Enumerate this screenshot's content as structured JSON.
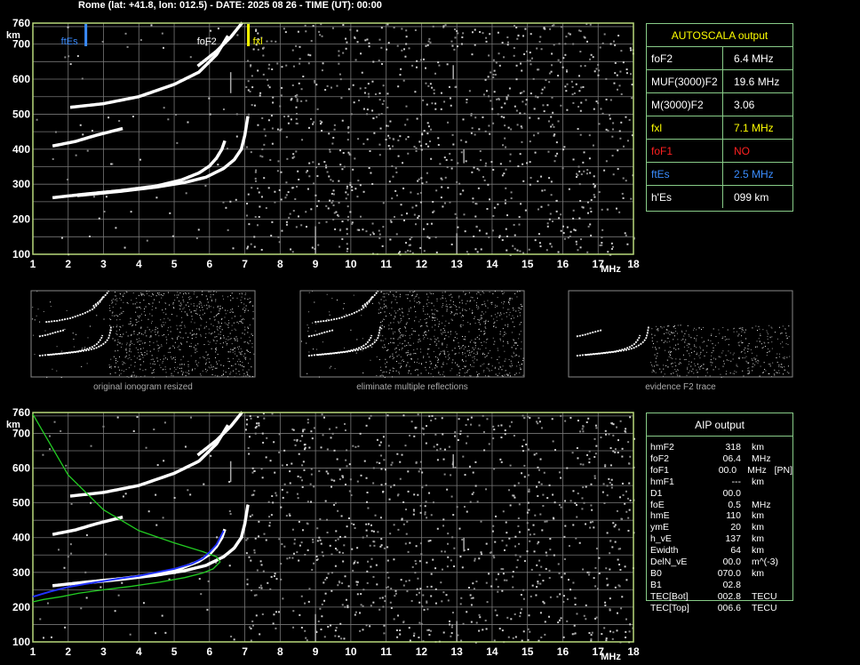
{
  "header": "Rome (lat: +41.8, lon: 012.5) - DATE: 2025 08 26 - TIME (UT): 00:00",
  "colors": {
    "grid": "#777777",
    "frame": "#b8d87a",
    "fxl": "#ffff00",
    "ftes": "#3a8cff",
    "fof1": "#ff2020",
    "model": "#22cc22",
    "profile": "#2233ff"
  },
  "chart_data": [
    {
      "type": "scatter",
      "name": "ionogram",
      "x_ticks": [
        1,
        2,
        3,
        4,
        5,
        6,
        7,
        8,
        9,
        10,
        11,
        12,
        13,
        14,
        15,
        16,
        17,
        18
      ],
      "y_ticks": [
        100,
        200,
        300,
        400,
        500,
        600,
        700,
        760
      ],
      "xlim": [
        1,
        18
      ],
      "ylim": [
        100,
        760
      ],
      "xlabel": "MHz",
      "ylabel": "km",
      "grid": true,
      "markers": [
        {
          "label": "ftEs",
          "x": 2.5
        },
        {
          "label": "foF2",
          "x": 6.4
        },
        {
          "label": "fxl",
          "x": 7.1
        }
      ],
      "traces": [
        {
          "name": "F2 ordinary low",
          "x": [
            1.6,
            2.5,
            3.5,
            4.5,
            5.2,
            5.7,
            6.0,
            6.2,
            6.35,
            6.42
          ],
          "y": [
            262,
            272,
            282,
            295,
            312,
            332,
            352,
            375,
            400,
            420
          ]
        },
        {
          "name": "F2 extraordinary low",
          "x": [
            2.3,
            3.5,
            4.5,
            5.3,
            5.9,
            6.4,
            6.7,
            6.9,
            7.0,
            7.08
          ],
          "y": [
            268,
            280,
            292,
            305,
            320,
            345,
            370,
            400,
            440,
            490
          ]
        },
        {
          "name": "F2 second hop",
          "x": [
            1.6,
            2.2,
            2.8,
            3.5
          ],
          "y": [
            410,
            422,
            440,
            458
          ]
        },
        {
          "name": "F2 upper branch",
          "x": [
            2.1,
            3.0,
            4.0,
            5.0,
            5.7,
            6.2,
            6.5
          ],
          "y": [
            520,
            530,
            550,
            585,
            620,
            670,
            720
          ]
        },
        {
          "name": "F2 upper x branch",
          "x": [
            5.7,
            6.2,
            6.6,
            6.9
          ],
          "y": [
            640,
            680,
            720,
            758
          ]
        }
      ]
    },
    {
      "type": "line",
      "name": "aip-profile",
      "x_ticks": [
        1,
        2,
        3,
        4,
        5,
        6,
        7,
        8,
        9,
        10,
        11,
        12,
        13,
        14,
        15,
        16,
        17,
        18
      ],
      "y_ticks": [
        100,
        200,
        300,
        400,
        500,
        600,
        700,
        760
      ],
      "xlim": [
        1,
        18
      ],
      "ylim": [
        100,
        760
      ],
      "xlabel": "MHz",
      "ylabel": "km",
      "grid": true,
      "model_curve": {
        "x": [
          1.0,
          1.3,
          1.8,
          2.3,
          3.0,
          3.8,
          4.6,
          5.3,
          5.8,
          6.1,
          6.3,
          6.2,
          5.8,
          5.0,
          4.0,
          3.0,
          2.0,
          1.0
        ],
        "y": [
          215,
          222,
          230,
          240,
          250,
          260,
          272,
          285,
          298,
          310,
          330,
          345,
          360,
          385,
          420,
          480,
          580,
          755
        ]
      },
      "profile_curve": {
        "x": [
          1.0,
          1.5,
          2.0,
          2.5,
          3.0,
          3.5,
          4.0,
          4.5,
          5.0,
          5.5,
          5.8,
          6.0,
          6.2,
          6.3,
          6.4
        ],
        "y": [
          230,
          245,
          258,
          267,
          275,
          283,
          290,
          300,
          310,
          325,
          340,
          358,
          380,
          400,
          420
        ]
      }
    }
  ],
  "thumbnails": [
    {
      "caption": "original ionogram resized"
    },
    {
      "caption": "eliminate multiple reflections"
    },
    {
      "caption": "evidence F2 trace"
    }
  ],
  "autoscala": {
    "title": "AUTOSCALA output",
    "rows": [
      {
        "label": "foF2",
        "value": "6.4 MHz",
        "color": "#ffffff"
      },
      {
        "label": "MUF(3000)F2",
        "value": "19.6 MHz",
        "color": "#ffffff"
      },
      {
        "label": "M(3000)F2",
        "value": "3.06",
        "color": "#ffffff"
      },
      {
        "label": "fxl",
        "value": "7.1 MHz",
        "color": "#ffff00"
      },
      {
        "label": "foF1",
        "value": "NO",
        "color": "#ff2020"
      },
      {
        "label": "ftEs",
        "value": "2.5 MHz",
        "color": "#3a8cff"
      },
      {
        "label": "h'Es",
        "value": "099 km",
        "color": "#ffffff"
      }
    ]
  },
  "aip": {
    "title": "AIP output",
    "rows": [
      {
        "label": "hmF2",
        "value": "318",
        "unit": "km",
        "extra": ""
      },
      {
        "label": "foF2",
        "value": "06.4",
        "unit": "MHz",
        "extra": ""
      },
      {
        "label": "foF1",
        "value": "00.0",
        "unit": "MHz",
        "extra": "[PN]"
      },
      {
        "label": "hmF1",
        "value": "---",
        "unit": "km",
        "extra": ""
      },
      {
        "label": "D1",
        "value": "00.0",
        "unit": "",
        "extra": ""
      },
      {
        "label": "foE",
        "value": "0.5",
        "unit": "MHz",
        "extra": ""
      },
      {
        "label": "hmE",
        "value": "110",
        "unit": "km",
        "extra": ""
      },
      {
        "label": "ymE",
        "value": "20",
        "unit": "km",
        "extra": ""
      },
      {
        "label": "h_vE",
        "value": "137",
        "unit": "km",
        "extra": ""
      },
      {
        "label": "Ewidth",
        "value": "64",
        "unit": "km",
        "extra": ""
      },
      {
        "label": "DelN_vE",
        "value": "00.0",
        "unit": "m^(-3)",
        "extra": ""
      },
      {
        "label": "B0",
        "value": "070.0",
        "unit": "km",
        "extra": ""
      },
      {
        "label": "B1",
        "value": "02.8",
        "unit": "",
        "extra": ""
      },
      {
        "label": "TEC[Bot]",
        "value": "002.8",
        "unit": "TECU",
        "extra": ""
      },
      {
        "label": "TEC[Top]",
        "value": "006.6",
        "unit": "TECU",
        "extra": ""
      }
    ]
  }
}
